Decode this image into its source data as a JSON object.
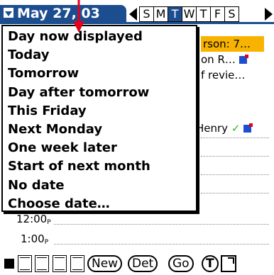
{
  "header": {
    "date_label": "May 27, 03",
    "weekdays": [
      "S",
      "M",
      "T",
      "W",
      "T",
      "F",
      "S"
    ],
    "selected_index": 2
  },
  "day_view": {
    "event1": "rson: 7…",
    "event2": "on R…",
    "event3": "f revie…",
    "henry_event": "Henry",
    "time_12": "12:00",
    "time_1": "1:00",
    "time_suffix": "P"
  },
  "date_menu": {
    "items": [
      "Day now displayed",
      "Today",
      "Tomorrow",
      "Day after tomorrow",
      "This Friday",
      "Next Monday",
      "One week later",
      "Start of next month",
      "No date",
      "Choose date…"
    ]
  },
  "toolbar": {
    "new_label": "New",
    "details_label": "Det",
    "go_label": "Go",
    "today_label": "T"
  },
  "colors": {
    "header_blue": "#1c4e8f",
    "highlight_orange": "#f8b300",
    "check_green": "#33b126",
    "annotation_red": "#e3001b"
  }
}
